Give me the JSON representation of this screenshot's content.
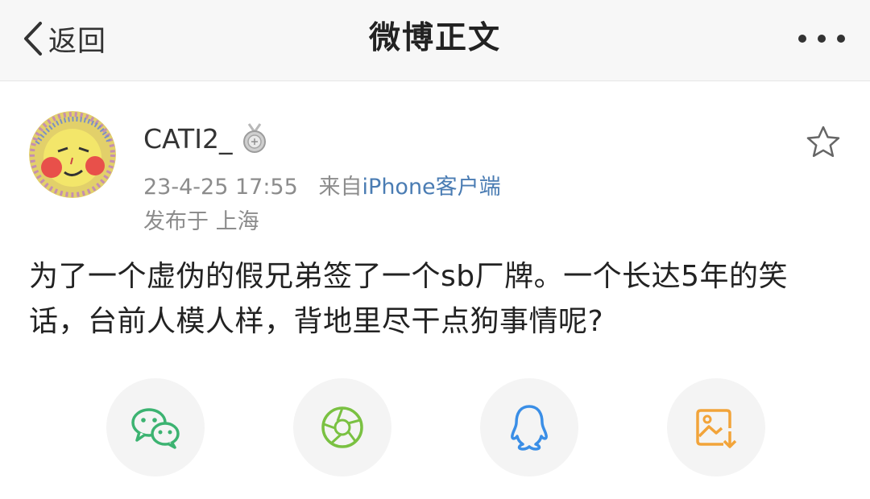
{
  "nav": {
    "back_label": "返回",
    "title": "微博正文",
    "more_icon": "more-dots-icon"
  },
  "post": {
    "username": "CATI2_",
    "badge_icon": "silver-medal-icon",
    "time": "23-4-25 17:55",
    "source_prefix": "来自",
    "source_link": "iPhone",
    "source_suffix": "客户端",
    "location": "发布于 上海",
    "content": "为了一个虚伪的假兄弟签了一个sb厂牌。一个长达5年的笑话，台前人模人样，背地里尽干点狗事情呢?",
    "favorite_icon": "star-outline-icon"
  },
  "share": {
    "items": [
      {
        "name": "wechat",
        "icon": "wechat-icon",
        "color": "#3cb371"
      },
      {
        "name": "moments",
        "icon": "moments-icon",
        "color": "#7ac142"
      },
      {
        "name": "qq",
        "icon": "qq-icon",
        "color": "#3a8ee6"
      },
      {
        "name": "save-image",
        "icon": "save-image-icon",
        "color": "#f2a43a"
      }
    ]
  },
  "colors": {
    "link": "#4a7cb3",
    "meta_text": "#8c8c8c",
    "nav_bg": "#f7f7f7"
  }
}
